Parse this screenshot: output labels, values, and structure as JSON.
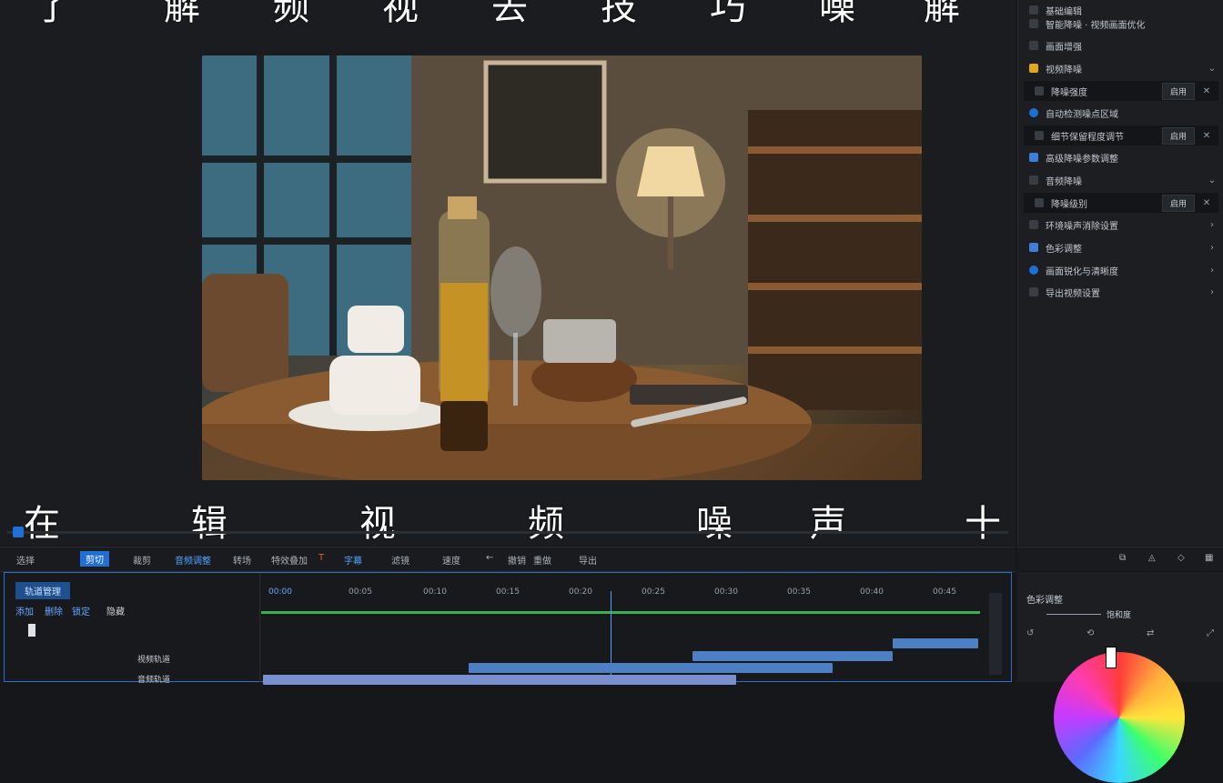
{
  "subtitles": {
    "top": [
      "了",
      "解",
      "频",
      "视",
      "去",
      "技",
      "巧",
      "噪",
      "解"
    ],
    "bottom": [
      "在",
      "辑",
      "视",
      "频",
      "噪",
      "声",
      "十"
    ]
  },
  "right_panel": {
    "rows": [
      {
        "label": "基础编辑",
        "arrow": ""
      },
      {
        "label": "智能降噪 · 视频画面优化",
        "arrow": ""
      },
      {
        "label": "画面增强",
        "arrow": ""
      },
      {
        "label": "视频降噪",
        "arrow": "⌄"
      },
      {
        "label": "降噪强度",
        "arrow": "✕",
        "button": "启用",
        "sub": true
      },
      {
        "label": "自动检测噪点区域",
        "arrow": ""
      },
      {
        "label": "细节保留程度调节",
        "arrow": "✕",
        "button": "启用",
        "sub": true
      },
      {
        "label": "高级降噪参数调整",
        "arrow": ""
      },
      {
        "label": "音频降噪",
        "arrow": "⌄"
      },
      {
        "label": "降噪级别",
        "arrow": "✕",
        "button": "启用",
        "sub": true
      },
      {
        "label": "环境噪声消除设置",
        "arrow": "›"
      },
      {
        "label": "色彩调整",
        "arrow": "›"
      },
      {
        "label": "画面锐化与清晰度",
        "arrow": "›"
      },
      {
        "label": "导出视频设置",
        "arrow": "›"
      }
    ]
  },
  "toolbar": {
    "items": [
      "选择",
      "剪切",
      "裁剪",
      "音频调整",
      "转场",
      "特效叠加",
      "T",
      "字幕",
      "滤镜",
      "速度",
      "←",
      "撤销",
      "重做",
      "导出"
    ],
    "active_index": 1
  },
  "timeline": {
    "header_title": "轨道管理",
    "header_tools": [
      "添加",
      "删除",
      "锁定",
      "隐藏"
    ],
    "track_labels": [
      "视频轨道",
      "音频轨道"
    ],
    "ticks": [
      "00:00",
      "00:05",
      "00:10",
      "00:15",
      "00:20",
      "00:25",
      "00:30",
      "00:35",
      "00:40",
      "00:45"
    ]
  },
  "color_panel": {
    "title": "色彩调整",
    "slider_label": "饱和度"
  },
  "colors": {
    "accent": "#1f6fd6",
    "clip": "#4d7fc4",
    "playhead_track": "#37b24d"
  }
}
